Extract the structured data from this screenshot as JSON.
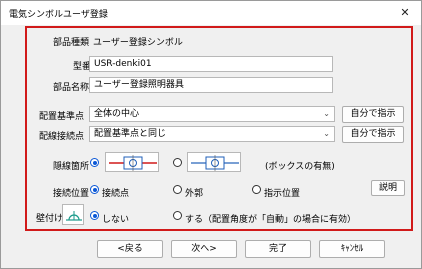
{
  "window": {
    "title": "電気シンボルユーザ登録",
    "close_glyph": "✕"
  },
  "form": {
    "part_type_label": "部品種類",
    "part_type_value": "ユーザー登録シンボル",
    "model_label": "型番",
    "model_value": "USR-denki01",
    "part_name_label": "部品名称",
    "part_name_value": "ユーザー登録照明器具",
    "base_point_label": "配置基準点",
    "base_point_value": "全体の中心",
    "base_point_button": "自分で指示",
    "wiring_point_label": "配線接続点",
    "wiring_point_value": "配置基準点と同じ",
    "wiring_point_button": "自分で指示",
    "hidden_label": "隠線箇所",
    "box_note": "(ボックスの有無)",
    "connection_label": "接続位置",
    "connection_options": [
      "接続点",
      "外郭",
      "指示位置"
    ],
    "explain_button": "説明",
    "wall_label": "壁付け",
    "wall_options": [
      "しない",
      "する（配置角度が「自動」の場合に有効）"
    ]
  },
  "footer": {
    "back": "<戻る",
    "next": "次へ>",
    "finish": "完了",
    "cancel": "ｷｬﾝｾﾙ"
  },
  "colors": {
    "panel_border": "#d11a1a",
    "radio_selected": "#0b58d6",
    "symbol_red": "#d11a1a",
    "symbol_blue": "#1f5fb8",
    "wall_icon": "#1a9a8a"
  }
}
